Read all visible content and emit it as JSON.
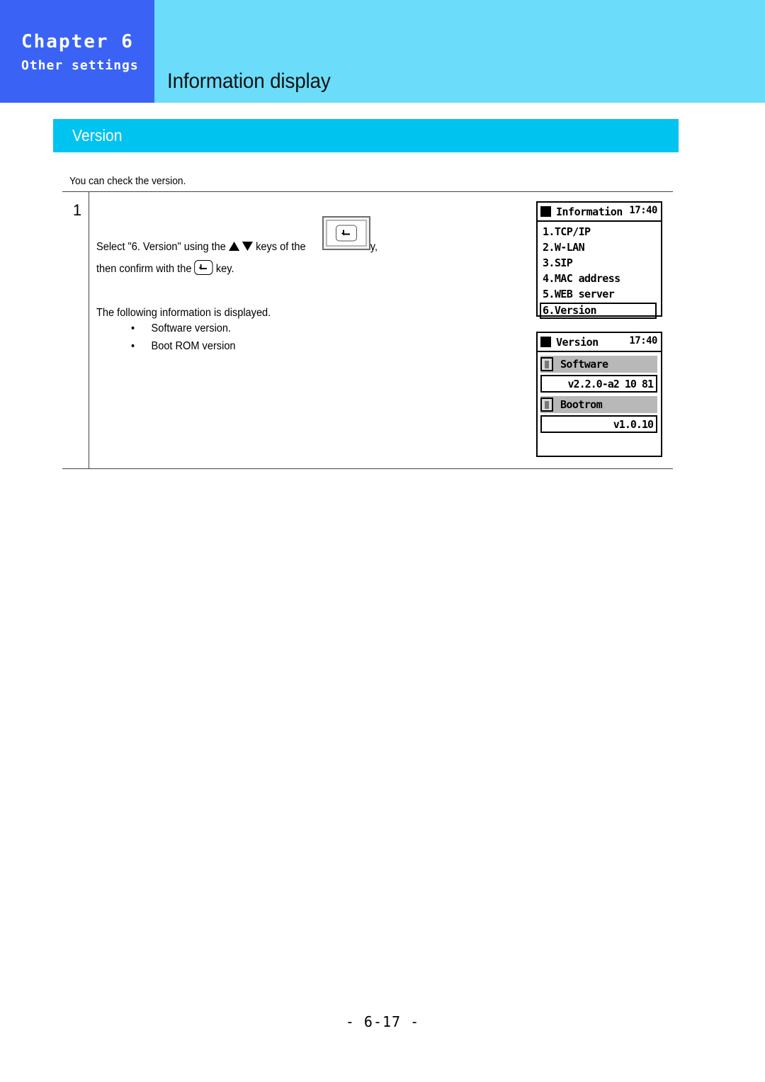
{
  "header": {
    "chapter": "Chapter 6",
    "chapter_subtitle": "Other settings",
    "page_title": "Information display",
    "chapter_box_color": "#3A63F5",
    "band_color": "#6BDDFA"
  },
  "section": {
    "label": "Version",
    "bar_color": "#00C3F0"
  },
  "intro": {
    "text": "You can check the version."
  },
  "step": {
    "number": "1",
    "select_prefix": "Select \"6. Version\" using the",
    "select_mid": "keys of the",
    "select_suffix": "key,",
    "confirm_prefix": "then confirm with the",
    "confirm_suffix": "key.",
    "following_text": "The following information is displayed.",
    "bullets": [
      "Software version.",
      "Boot ROM version"
    ],
    "bullet_glyph": "•"
  },
  "lcd_information": {
    "title": "Information",
    "time": "17:40",
    "items": [
      {
        "label": "1.TCP/IP",
        "selected": false
      },
      {
        "label": "2.W-LAN",
        "selected": false
      },
      {
        "label": "3.SIP",
        "selected": false
      },
      {
        "label": "4.MAC address",
        "selected": false
      },
      {
        "label": "5.WEB server",
        "selected": false
      },
      {
        "label": "6.Version",
        "selected": true
      }
    ]
  },
  "lcd_version": {
    "title": "Version",
    "time": "17:40",
    "fields": [
      {
        "label": "Software",
        "value": "v2.2.0-a2 10 81"
      },
      {
        "label": "Bootrom",
        "value": "v1.0.10"
      }
    ]
  },
  "footer": {
    "page_number": "-  6-17  -"
  }
}
